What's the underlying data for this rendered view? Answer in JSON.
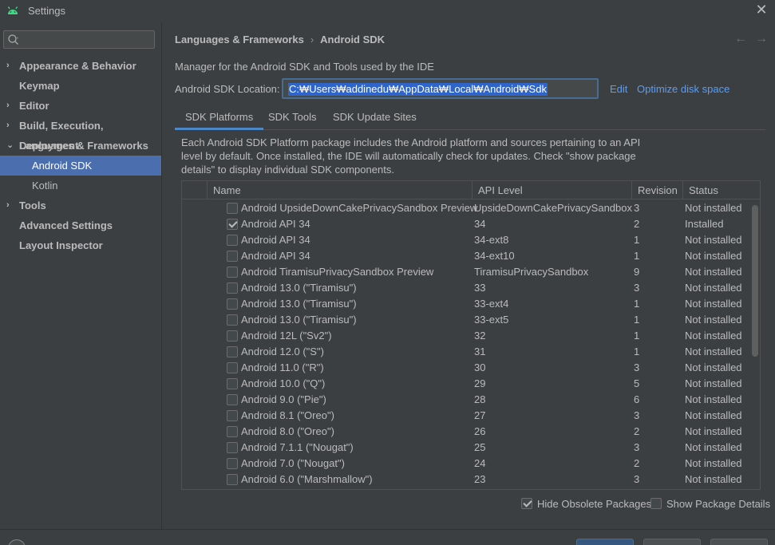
{
  "window": {
    "title": "Settings"
  },
  "sidebar": {
    "search_placeholder": "",
    "items": [
      {
        "label": "Appearance & Behavior",
        "arrow": "›",
        "bold": true,
        "indent": 0,
        "selected": false
      },
      {
        "label": "Keymap",
        "arrow": "",
        "bold": true,
        "indent": 0,
        "selected": false
      },
      {
        "label": "Editor",
        "arrow": "›",
        "bold": true,
        "indent": 0,
        "selected": false
      },
      {
        "label": "Build, Execution, Deployment",
        "arrow": "›",
        "bold": true,
        "indent": 0,
        "selected": false
      },
      {
        "label": "Languages & Frameworks",
        "arrow": "⌄",
        "bold": true,
        "indent": 0,
        "selected": false
      },
      {
        "label": "Android SDK",
        "arrow": "",
        "bold": false,
        "indent": 1,
        "selected": true
      },
      {
        "label": "Kotlin",
        "arrow": "",
        "bold": false,
        "indent": 1,
        "selected": false
      },
      {
        "label": "Tools",
        "arrow": "›",
        "bold": true,
        "indent": 0,
        "selected": false
      },
      {
        "label": "Advanced Settings",
        "arrow": "",
        "bold": true,
        "indent": 0,
        "selected": false
      },
      {
        "label": "Layout Inspector",
        "arrow": "",
        "bold": true,
        "indent": 0,
        "selected": false
      }
    ]
  },
  "breadcrumb": {
    "parent": "Languages & Frameworks",
    "separator": "›",
    "current": "Android SDK"
  },
  "nav": {
    "back": "←",
    "forward": "→"
  },
  "main": {
    "description": "Manager for the Android SDK and Tools used by the IDE",
    "location_label": "Android SDK Location:",
    "location_value": "C:₩Users₩addinedu₩AppData₩Local₩Android₩Sdk",
    "edit_link": "Edit",
    "optimize_link": "Optimize disk space",
    "tabs": [
      "SDK Platforms",
      "SDK Tools",
      "SDK Update Sites"
    ],
    "active_tab": 0,
    "platform_description": "Each Android SDK Platform package includes the Android platform and sources pertaining to an API level by default. Once installed, the IDE will automatically check for updates. Check \"show package details\" to display individual SDK components."
  },
  "table": {
    "columns": [
      "Name",
      "API Level",
      "Revision",
      "Status"
    ],
    "rows": [
      {
        "checked": false,
        "name": "Android UpsideDownCakePrivacySandbox Preview",
        "api": "UpsideDownCakePrivacySandbox",
        "revision": "3",
        "status": "Not installed"
      },
      {
        "checked": true,
        "name": "Android API 34",
        "api": "34",
        "revision": "2",
        "status": "Installed"
      },
      {
        "checked": false,
        "name": "Android API 34",
        "api": "34-ext8",
        "revision": "1",
        "status": "Not installed"
      },
      {
        "checked": false,
        "name": "Android API 34",
        "api": "34-ext10",
        "revision": "1",
        "status": "Not installed"
      },
      {
        "checked": false,
        "name": "Android TiramisuPrivacySandbox Preview",
        "api": "TiramisuPrivacySandbox",
        "revision": "9",
        "status": "Not installed"
      },
      {
        "checked": false,
        "name": "Android 13.0 (\"Tiramisu\")",
        "api": "33",
        "revision": "3",
        "status": "Not installed"
      },
      {
        "checked": false,
        "name": "Android 13.0 (\"Tiramisu\")",
        "api": "33-ext4",
        "revision": "1",
        "status": "Not installed"
      },
      {
        "checked": false,
        "name": "Android 13.0 (\"Tiramisu\")",
        "api": "33-ext5",
        "revision": "1",
        "status": "Not installed"
      },
      {
        "checked": false,
        "name": "Android 12L (\"Sv2\")",
        "api": "32",
        "revision": "1",
        "status": "Not installed"
      },
      {
        "checked": false,
        "name": "Android 12.0 (\"S\")",
        "api": "31",
        "revision": "1",
        "status": "Not installed"
      },
      {
        "checked": false,
        "name": "Android 11.0 (\"R\")",
        "api": "30",
        "revision": "3",
        "status": "Not installed"
      },
      {
        "checked": false,
        "name": "Android 10.0 (\"Q\")",
        "api": "29",
        "revision": "5",
        "status": "Not installed"
      },
      {
        "checked": false,
        "name": "Android 9.0 (\"Pie\")",
        "api": "28",
        "revision": "6",
        "status": "Not installed"
      },
      {
        "checked": false,
        "name": "Android 8.1 (\"Oreo\")",
        "api": "27",
        "revision": "3",
        "status": "Not installed"
      },
      {
        "checked": false,
        "name": "Android 8.0 (\"Oreo\")",
        "api": "26",
        "revision": "2",
        "status": "Not installed"
      },
      {
        "checked": false,
        "name": "Android 7.1.1 (\"Nougat\")",
        "api": "25",
        "revision": "3",
        "status": "Not installed"
      },
      {
        "checked": false,
        "name": "Android 7.0 (\"Nougat\")",
        "api": "24",
        "revision": "2",
        "status": "Not installed"
      },
      {
        "checked": false,
        "name": "Android 6.0 (\"Marshmallow\")",
        "api": "23",
        "revision": "3",
        "status": "Not installed"
      }
    ]
  },
  "options": {
    "hide_obsolete": {
      "label": "Hide Obsolete Packages",
      "checked": true
    },
    "show_details": {
      "label": "Show Package Details",
      "checked": false
    }
  },
  "colors": {
    "accent": "#4b6eaf",
    "link": "#589df6",
    "background": "#3c3f41",
    "android_green": "#3ddc84"
  }
}
